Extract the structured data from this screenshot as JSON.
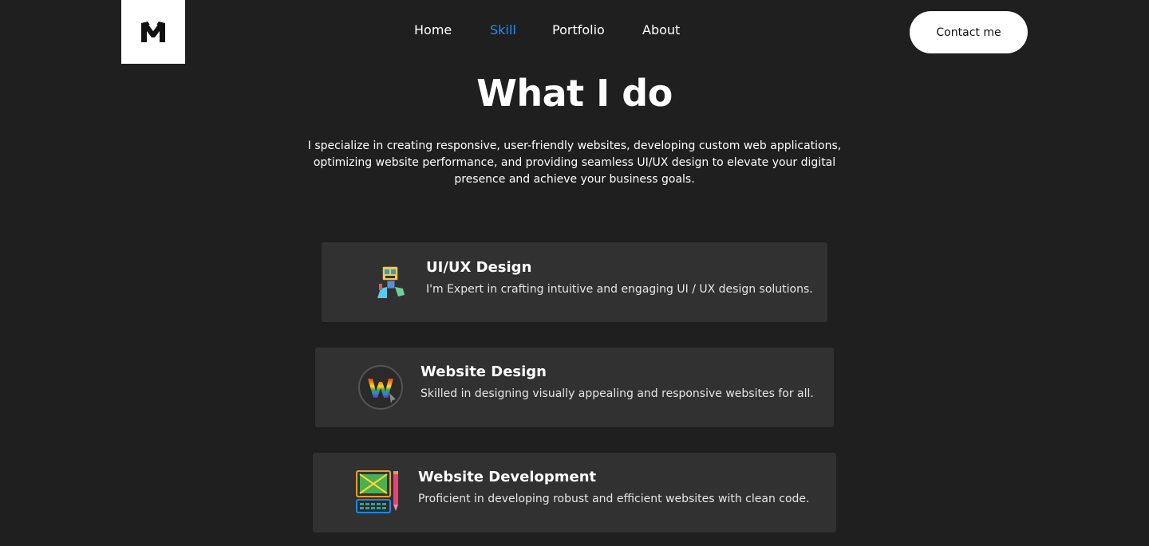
{
  "header": {
    "nav": [
      {
        "label": "Home",
        "active": false
      },
      {
        "label": "Skill",
        "active": true
      },
      {
        "label": "Portfolio",
        "active": false
      },
      {
        "label": "About",
        "active": false
      }
    ],
    "contact_label": "Contact me",
    "logo_icon": "m-monogram-logo"
  },
  "hero": {
    "title": "What I do",
    "description": "I specialize in creating responsive, user-friendly websites, developing custom web applications, optimizing website performance, and providing seamless UI/UX design to elevate your digital presence and achieve your business goals."
  },
  "services": [
    {
      "title": "UI/UX Design",
      "description": "I'm Expert in crafting intuitive and engaging UI / UX design solutions.",
      "icon": "designer-robot-icon"
    },
    {
      "title": "Website Design",
      "description": "Skilled in designing visually appealing and responsive websites for all.",
      "icon": "rainbow-w-icon"
    },
    {
      "title": "Website Development",
      "description": "Proficient in developing robust and efficient websites with clean code.",
      "icon": "computer-pencil-icon"
    }
  ],
  "colors": {
    "background": "#1f1f1f",
    "card": "#313131",
    "accent": "#1e90ff"
  }
}
